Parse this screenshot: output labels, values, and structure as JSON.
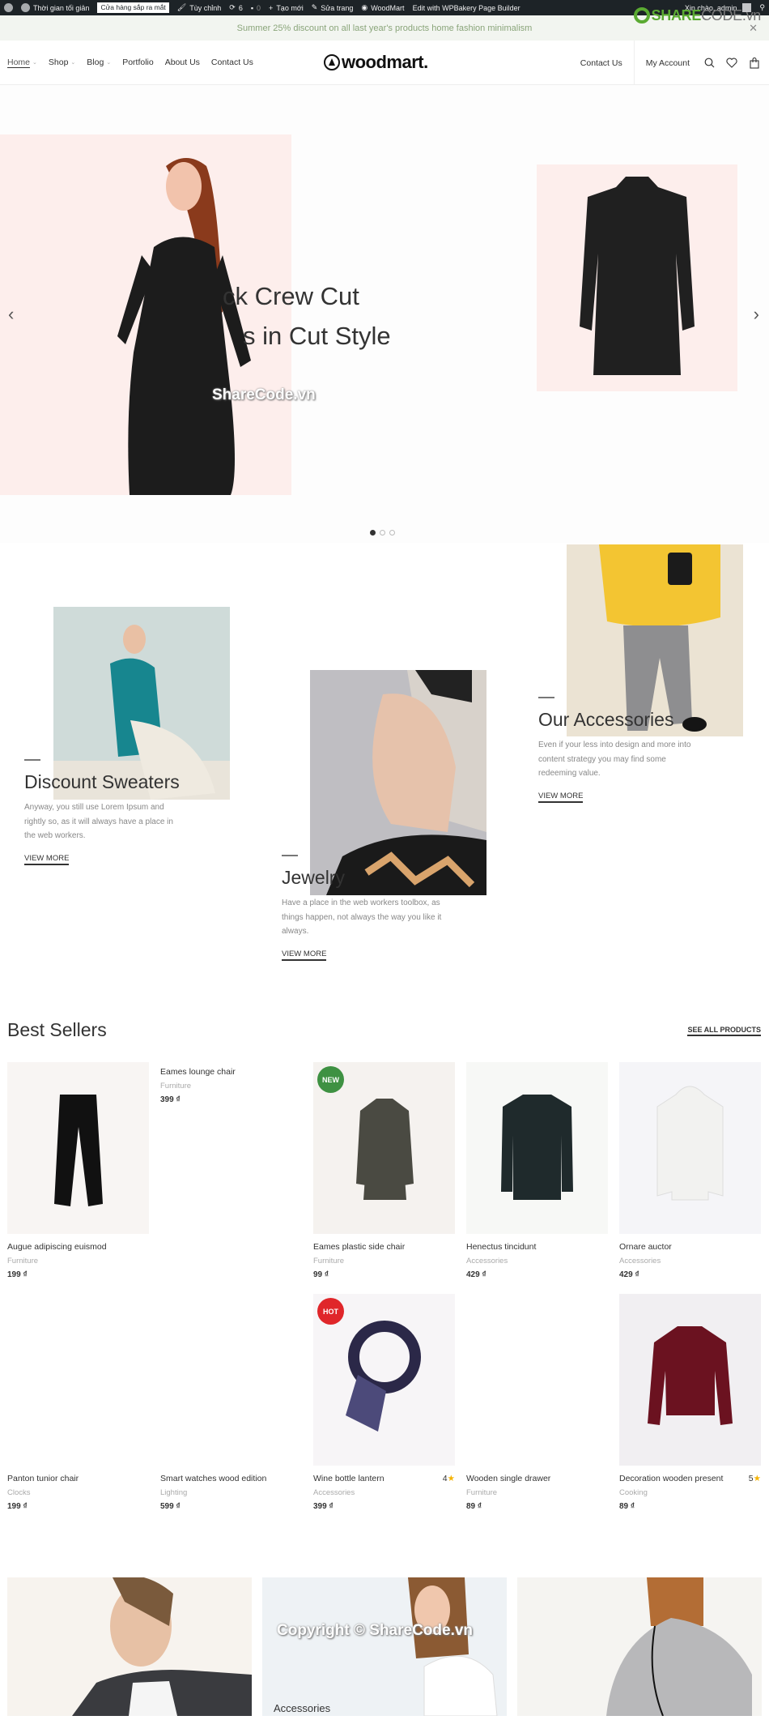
{
  "admin_bar": {
    "items": [
      {
        "icon": "wordpress-icon",
        "label": ""
      },
      {
        "icon": "dashboard-icon",
        "label": "Thời gian tối giản"
      },
      {
        "icon": "",
        "label": "Cửa hàng sắp ra mắt"
      },
      {
        "icon": "brush-icon",
        "label": "Tùy chỉnh"
      },
      {
        "icon": "update-icon",
        "label": "6"
      },
      {
        "icon": "comment-icon",
        "label": "0"
      },
      {
        "icon": "plus-icon",
        "label": "Tạo mới"
      },
      {
        "icon": "pencil-icon",
        "label": "Sửa trang"
      },
      {
        "icon": "woodmart-icon",
        "label": "WoodMart"
      },
      {
        "icon": "",
        "label": "Edit with WPBakery Page Builder"
      }
    ],
    "greeting": "Xin chào, admin"
  },
  "promo": {
    "text": "Summer 25% discount on all last year's products home fashion minimalism",
    "watermark_brand": "SHARE",
    "watermark_brand2": "CODE.vn"
  },
  "header": {
    "nav": [
      {
        "label": "Home",
        "dropdown": true,
        "active": true
      },
      {
        "label": "Shop",
        "dropdown": true
      },
      {
        "label": "Blog",
        "dropdown": true
      },
      {
        "label": "Portfolio"
      },
      {
        "label": "About Us"
      },
      {
        "label": "Contact Us"
      }
    ],
    "logo": "woodmart.",
    "contact": "Contact Us",
    "account": "My Account"
  },
  "slider": {
    "title_line1": "Black Crew Cut",
    "title_line2": "Dress in Cut Style",
    "title_visible1": "ck Crew Cut",
    "title_visible2": "s in Cut Style",
    "watermark": "ShareCode.vn",
    "slides": 3,
    "current_slide": 1
  },
  "categories": [
    {
      "title": "Discount Sweaters",
      "desc": "Anyway, you still use Lorem Ipsum and rightly so, as it will always have a place in the web workers.",
      "link": "VIEW MORE"
    },
    {
      "title": "Jewelry",
      "desc": "Have a place in the web workers toolbox, as things happen, not always the way you like it always.",
      "link": "VIEW MORE"
    },
    {
      "title": "Our Accessories",
      "desc": "Even if your less into design and more into content strategy you may find some redeeming value.",
      "link": "VIEW MORE"
    }
  ],
  "best_sellers": {
    "title": "Best Sellers",
    "see_all": "SEE ALL PRODUCTS",
    "products": [
      {
        "name": "Augue adipiscing euismod",
        "category": "Furniture",
        "price": "199 ₫",
        "badge": "",
        "rating": ""
      },
      {
        "name": "Eames lounge chair",
        "category": "Furniture",
        "price": "399 ₫",
        "badge": "",
        "rating": ""
      },
      {
        "name": "Eames plastic side chair",
        "category": "Furniture",
        "price": "99 ₫",
        "badge": "NEW",
        "rating": ""
      },
      {
        "name": "Henectus tincidunt",
        "category": "Accessories",
        "price": "429 ₫",
        "badge": "",
        "rating": ""
      },
      {
        "name": "Ornare auctor",
        "category": "Accessories",
        "price": "429 ₫",
        "badge": "",
        "rating": ""
      },
      {
        "name": "Panton tunior chair",
        "category": "Clocks",
        "price": "199 ₫",
        "badge": "",
        "rating": ""
      },
      {
        "name": "Smart watches wood edition",
        "category": "Lighting",
        "price": "599 ₫",
        "badge": "",
        "rating": ""
      },
      {
        "name": "Wine bottle lantern",
        "category": "Accessories",
        "price": "399 ₫",
        "badge": "HOT",
        "rating": "4"
      },
      {
        "name": "Wooden single drawer",
        "category": "Furniture",
        "price": "89 ₫",
        "badge": "",
        "rating": ""
      },
      {
        "name": "Decoration wooden present",
        "category": "Cooking",
        "price": "89 ₫",
        "badge": "",
        "rating": "5"
      }
    ],
    "badge_colors": {
      "NEW": "#3e9142",
      "HOT": "#e0262a"
    }
  },
  "bottom_banners": [
    {
      "label": ""
    },
    {
      "label": "Accessories",
      "watermark": "Copyright © ShareCode.vn"
    },
    {
      "label": ""
    }
  ]
}
